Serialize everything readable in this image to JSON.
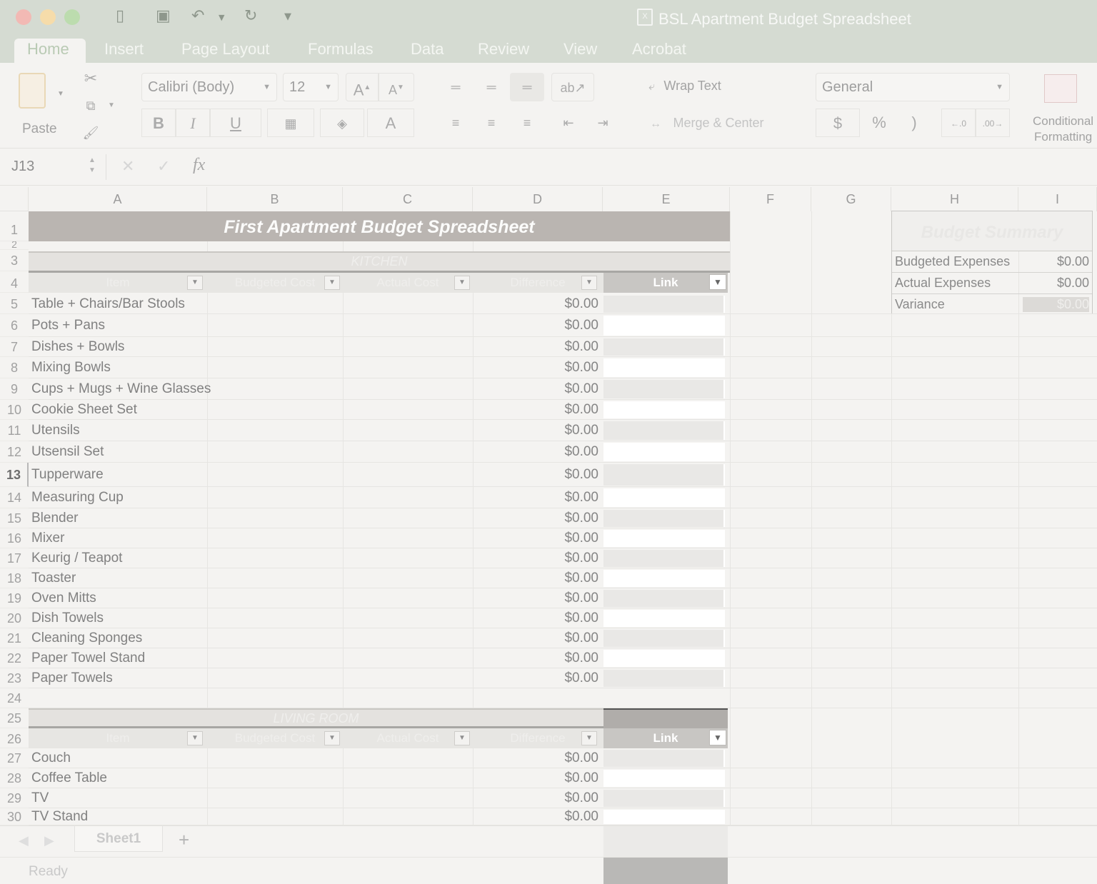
{
  "window": {
    "title": "BSL Apartment Budget Spreadsheet"
  },
  "ribbon_tabs": [
    "Home",
    "Insert",
    "Page Layout",
    "Formulas",
    "Data",
    "Review",
    "View",
    "Acrobat"
  ],
  "ribbon": {
    "paste_label": "Paste",
    "font_name": "Calibri (Body)",
    "font_size": "12",
    "wrap_text": "Wrap Text",
    "merge_center": "Merge & Center",
    "number_format": "General",
    "conditional_formatting_line1": "Conditional",
    "conditional_formatting_line2": "Formatting",
    "bold": "B",
    "italic": "I",
    "underline": "U",
    "dollar": "$",
    "percent": "%",
    "comma": ")"
  },
  "formula_bar": {
    "cell_ref": "J13",
    "fx": "fx",
    "cancel": "✕",
    "enter": "✓"
  },
  "columns": [
    "A",
    "B",
    "C",
    "D",
    "E",
    "F",
    "G",
    "H",
    "I"
  ],
  "sheet": {
    "title": "First Apartment Budget Spreadsheet",
    "kitchen_header": "KITCHEN",
    "living_header": "LIVING ROOM",
    "table_headers": [
      "Item",
      "Budgeted Cost",
      "Actual Cost",
      "Difference"
    ],
    "link_header": "Link",
    "kitchen_items": [
      {
        "row": "5",
        "item": "Table + Chairs/Bar Stools",
        "difference": "$0.00"
      },
      {
        "row": "6",
        "item": "Pots + Pans",
        "difference": "$0.00"
      },
      {
        "row": "7",
        "item": "Dishes + Bowls",
        "difference": "$0.00"
      },
      {
        "row": "8",
        "item": "Mixing Bowls",
        "difference": "$0.00"
      },
      {
        "row": "9",
        "item": "Cups + Mugs + Wine Glasses",
        "difference": "$0.00"
      },
      {
        "row": "10",
        "item": "Cookie Sheet Set",
        "difference": "$0.00"
      },
      {
        "row": "11",
        "item": "Utensils",
        "difference": "$0.00"
      },
      {
        "row": "12",
        "item": "Utsensil Set",
        "difference": "$0.00"
      },
      {
        "row": "13",
        "item": "Tupperware",
        "difference": "$0.00"
      },
      {
        "row": "14",
        "item": "Measuring Cup",
        "difference": "$0.00"
      },
      {
        "row": "15",
        "item": "Blender",
        "difference": "$0.00"
      },
      {
        "row": "16",
        "item": "Mixer",
        "difference": "$0.00"
      },
      {
        "row": "17",
        "item": "Keurig / Teapot",
        "difference": "$0.00"
      },
      {
        "row": "18",
        "item": "Toaster",
        "difference": "$0.00"
      },
      {
        "row": "19",
        "item": "Oven Mitts",
        "difference": "$0.00"
      },
      {
        "row": "20",
        "item": "Dish Towels",
        "difference": "$0.00"
      },
      {
        "row": "21",
        "item": "Cleaning Sponges",
        "difference": "$0.00"
      },
      {
        "row": "22",
        "item": "Paper Towel Stand",
        "difference": "$0.00"
      },
      {
        "row": "23",
        "item": "Paper Towels",
        "difference": "$0.00"
      }
    ],
    "living_items": [
      {
        "row": "27",
        "item": "Couch",
        "difference": "$0.00"
      },
      {
        "row": "28",
        "item": "Coffee Table",
        "difference": "$0.00"
      },
      {
        "row": "29",
        "item": "TV",
        "difference": "$0.00"
      },
      {
        "row": "30",
        "item": "TV Stand",
        "difference": "$0.00"
      }
    ],
    "row_numbers": {
      "r1": "1",
      "r2": "2",
      "r3": "3",
      "r4": "4",
      "r24": "24",
      "r25": "25",
      "r26": "26"
    }
  },
  "summary": {
    "title": "Budget Summary",
    "rows": [
      {
        "label": "Budgeted Expenses",
        "value": "$0.00"
      },
      {
        "label": "Actual Expenses",
        "value": "$0.00"
      },
      {
        "label": "Variance",
        "value": "$0.00"
      }
    ]
  },
  "sheet_tabs": {
    "active": "Sheet1",
    "add": "+"
  },
  "status": {
    "text": "Ready"
  },
  "colors": {
    "banner": "#bab5b1",
    "title_bar": "#d5dbd2",
    "link_header": "#c8c6c3"
  }
}
